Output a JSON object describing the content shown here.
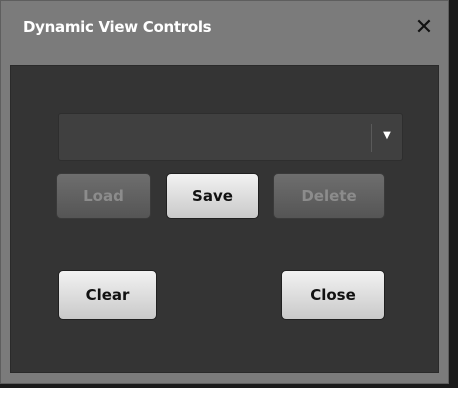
{
  "dialog": {
    "title": "Dynamic View Controls",
    "close_glyph": "✕",
    "close_icon": "close-icon"
  },
  "view_select": {
    "selected_value": "",
    "arrow_glyph": "▼",
    "arrow_icon": "chevron-down-icon"
  },
  "buttons": {
    "load": "Load",
    "save": "Save",
    "delete": "Delete",
    "clear": "Clear",
    "close": "Close"
  },
  "colors": {
    "dialog_frame": "#7b7b7b",
    "panel_background": "#343434",
    "button_face": "#e0e0e0",
    "disabled_button_face": "#5f5f5f"
  }
}
